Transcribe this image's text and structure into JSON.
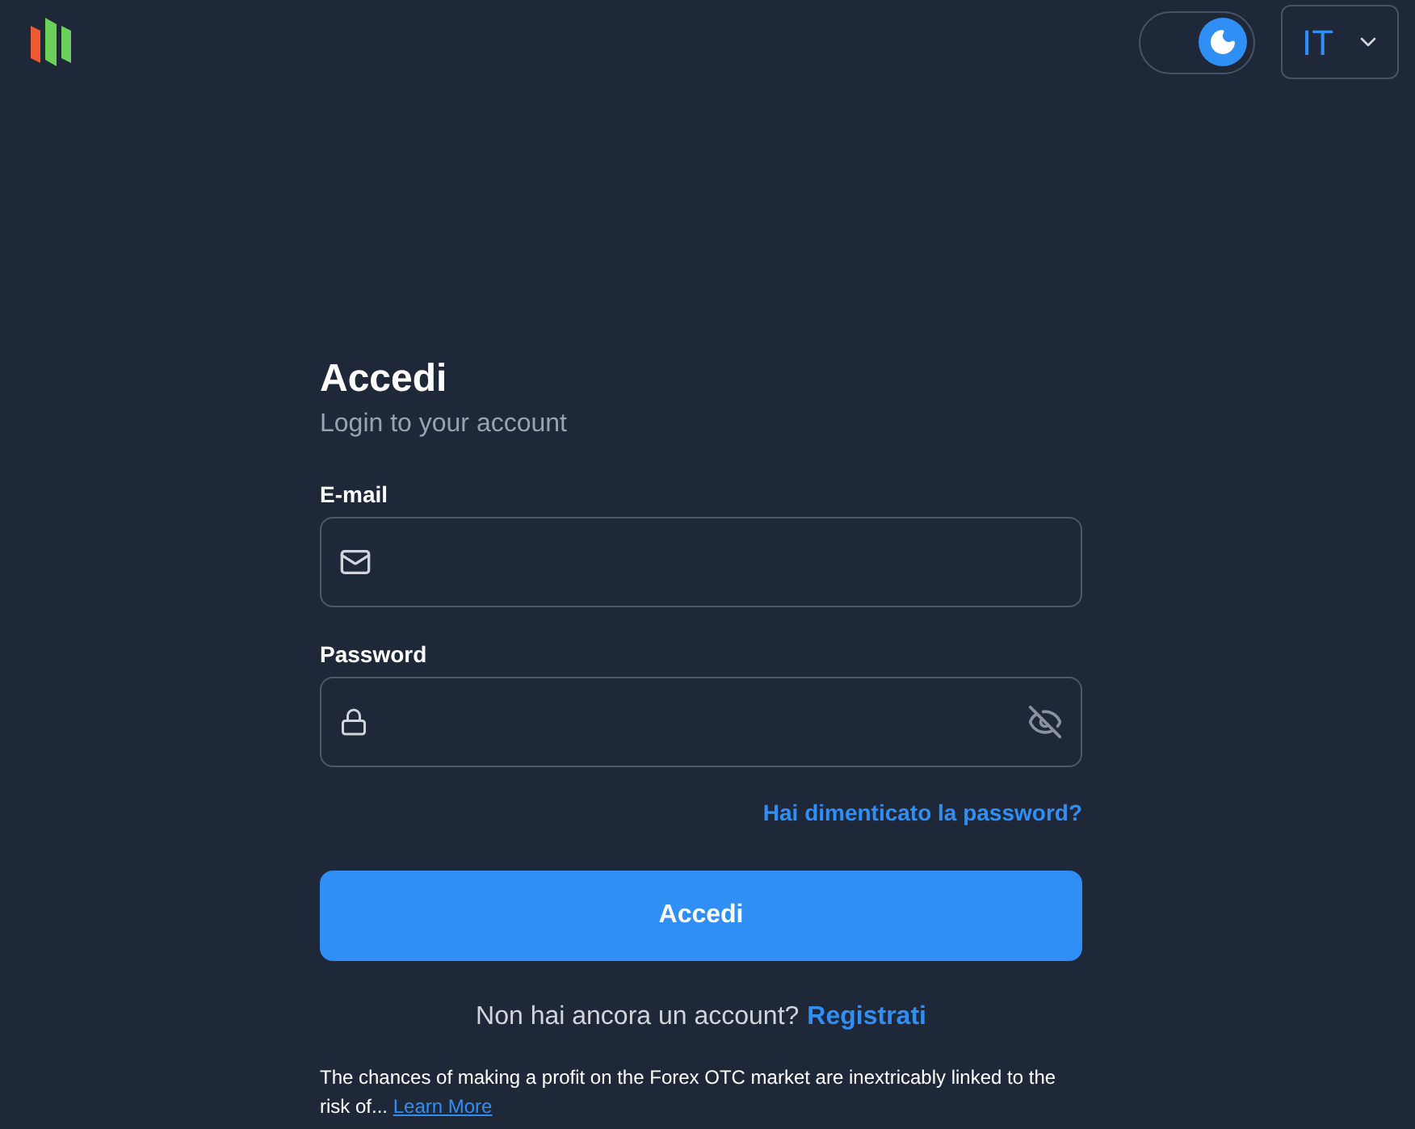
{
  "header": {
    "dark_mode": {
      "on": true
    },
    "language": {
      "value": "IT"
    }
  },
  "form": {
    "title": "Accedi",
    "subtitle": "Login to your account",
    "fields": [
      {
        "kind": "email",
        "label": "E-mail"
      },
      {
        "kind": "password",
        "label": "Password"
      }
    ],
    "forgot_link": "Hai dimenticato la password?",
    "submit": "Accedi",
    "signup_prompt": "Non hai ancora un account?",
    "signup_link": "Registrati",
    "disclaimer": "The chances of making a profit on the Forex OTC market are inextricably linked to the risk of...",
    "learn_more": "Learn More"
  }
}
